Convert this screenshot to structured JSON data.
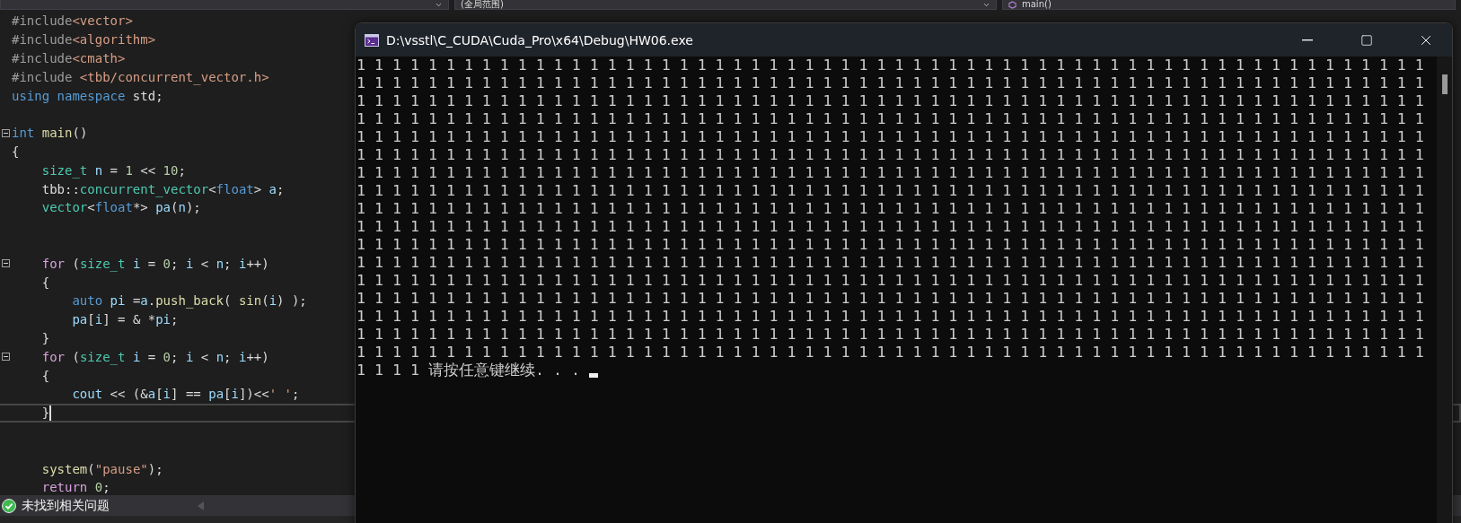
{
  "navigation_bar": {
    "scope": "(全局范围)",
    "member": "main()"
  },
  "editor": {
    "lines": [
      {
        "fold": false,
        "current": false,
        "tokens": [
          {
            "text": "#include",
            "kind": "pp"
          },
          {
            "text": "<vector>",
            "kind": "inc"
          }
        ]
      },
      {
        "fold": false,
        "current": false,
        "tokens": [
          {
            "text": "#include",
            "kind": "pp"
          },
          {
            "text": "<algorithm>",
            "kind": "inc"
          }
        ]
      },
      {
        "fold": false,
        "current": false,
        "tokens": [
          {
            "text": "#include",
            "kind": "pp"
          },
          {
            "text": "<cmath>",
            "kind": "inc"
          }
        ]
      },
      {
        "fold": false,
        "current": false,
        "tokens": [
          {
            "text": "#include",
            "kind": "pp"
          },
          {
            "text": " <tbb/concurrent_vector.h>",
            "kind": "inc"
          }
        ]
      },
      {
        "fold": false,
        "current": false,
        "tokens": [
          {
            "text": "using namespace",
            "kind": "kw"
          },
          {
            "text": " std;",
            "kind": "plain"
          }
        ]
      },
      {
        "fold": false,
        "current": false
      },
      {
        "fold": true,
        "current": false,
        "tokens": [
          {
            "text": "int",
            "kind": "kw"
          },
          {
            "text": " main",
            "kind": "fn"
          },
          {
            "text": "()",
            "kind": "plain"
          }
        ]
      },
      {
        "fold": false,
        "current": false,
        "tokens": [
          {
            "text": "{",
            "kind": "plain"
          }
        ]
      },
      {
        "fold": false,
        "current": false,
        "tokens": [
          {
            "text": "    size_t",
            "kind": "type"
          },
          {
            "text": " n",
            "kind": "var"
          },
          {
            "text": " = ",
            "kind": "plain"
          },
          {
            "text": "1",
            "kind": "num"
          },
          {
            "text": " << ",
            "kind": "plain"
          },
          {
            "text": "10",
            "kind": "num"
          },
          {
            "text": ";",
            "kind": "plain"
          }
        ]
      },
      {
        "fold": false,
        "current": false,
        "tokens": [
          {
            "text": "    tbb::",
            "kind": "plain"
          },
          {
            "text": "concurrent_vector",
            "kind": "type"
          },
          {
            "text": "<",
            "kind": "plain"
          },
          {
            "text": "float",
            "kind": "kw"
          },
          {
            "text": "> ",
            "kind": "plain"
          },
          {
            "text": "a",
            "kind": "var"
          },
          {
            "text": ";",
            "kind": "plain"
          }
        ]
      },
      {
        "fold": false,
        "current": false,
        "tokens": [
          {
            "text": "    vector",
            "kind": "type"
          },
          {
            "text": "<",
            "kind": "plain"
          },
          {
            "text": "float",
            "kind": "kw"
          },
          {
            "text": "*> ",
            "kind": "plain"
          },
          {
            "text": "pa",
            "kind": "var"
          },
          {
            "text": "(",
            "kind": "plain"
          },
          {
            "text": "n",
            "kind": "var"
          },
          {
            "text": ");",
            "kind": "plain"
          }
        ]
      },
      {
        "fold": false,
        "current": false
      },
      {
        "fold": false,
        "current": false
      },
      {
        "fold": true,
        "current": false,
        "tokens": [
          {
            "text": "    for",
            "kind": "ctl"
          },
          {
            "text": " (",
            "kind": "plain"
          },
          {
            "text": "size_t",
            "kind": "type"
          },
          {
            "text": " i",
            "kind": "var"
          },
          {
            "text": " = ",
            "kind": "plain"
          },
          {
            "text": "0",
            "kind": "num"
          },
          {
            "text": "; ",
            "kind": "plain"
          },
          {
            "text": "i",
            "kind": "var"
          },
          {
            "text": " < ",
            "kind": "plain"
          },
          {
            "text": "n",
            "kind": "var"
          },
          {
            "text": "; ",
            "kind": "plain"
          },
          {
            "text": "i",
            "kind": "var"
          },
          {
            "text": "++)",
            "kind": "plain"
          }
        ]
      },
      {
        "fold": false,
        "current": false,
        "tokens": [
          {
            "text": "    {",
            "kind": "plain"
          }
        ]
      },
      {
        "fold": false,
        "current": false,
        "tokens": [
          {
            "text": "        auto",
            "kind": "kw"
          },
          {
            "text": " pi",
            "kind": "var"
          },
          {
            "text": " =",
            "kind": "plain"
          },
          {
            "text": "a",
            "kind": "var"
          },
          {
            "text": ".",
            "kind": "plain"
          },
          {
            "text": "push_back",
            "kind": "fn"
          },
          {
            "text": "( ",
            "kind": "plain"
          },
          {
            "text": "sin",
            "kind": "fn"
          },
          {
            "text": "(",
            "kind": "plain"
          },
          {
            "text": "i",
            "kind": "var"
          },
          {
            "text": ") );",
            "kind": "plain"
          }
        ]
      },
      {
        "fold": false,
        "current": false,
        "tokens": [
          {
            "text": "        pa",
            "kind": "var"
          },
          {
            "text": "[",
            "kind": "plain"
          },
          {
            "text": "i",
            "kind": "var"
          },
          {
            "text": "] = & *",
            "kind": "plain"
          },
          {
            "text": "pi",
            "kind": "var"
          },
          {
            "text": ";",
            "kind": "plain"
          }
        ]
      },
      {
        "fold": false,
        "current": false,
        "tokens": [
          {
            "text": "    }",
            "kind": "plain"
          }
        ]
      },
      {
        "fold": true,
        "current": false,
        "tokens": [
          {
            "text": "    for",
            "kind": "ctl"
          },
          {
            "text": " (",
            "kind": "plain"
          },
          {
            "text": "size_t",
            "kind": "type"
          },
          {
            "text": " i",
            "kind": "var"
          },
          {
            "text": " = ",
            "kind": "plain"
          },
          {
            "text": "0",
            "kind": "num"
          },
          {
            "text": "; ",
            "kind": "plain"
          },
          {
            "text": "i",
            "kind": "var"
          },
          {
            "text": " < ",
            "kind": "plain"
          },
          {
            "text": "n",
            "kind": "var"
          },
          {
            "text": "; ",
            "kind": "plain"
          },
          {
            "text": "i",
            "kind": "var"
          },
          {
            "text": "++)",
            "kind": "plain"
          }
        ]
      },
      {
        "fold": false,
        "current": false,
        "tokens": [
          {
            "text": "    {",
            "kind": "plain"
          }
        ]
      },
      {
        "fold": false,
        "current": false,
        "tokens": [
          {
            "text": "        cout",
            "kind": "var"
          },
          {
            "text": " << (&",
            "kind": "plain"
          },
          {
            "text": "a",
            "kind": "var"
          },
          {
            "text": "[",
            "kind": "plain"
          },
          {
            "text": "i",
            "kind": "var"
          },
          {
            "text": "] == ",
            "kind": "plain"
          },
          {
            "text": "pa",
            "kind": "var"
          },
          {
            "text": "[",
            "kind": "plain"
          },
          {
            "text": "i",
            "kind": "var"
          },
          {
            "text": "])<<",
            "kind": "plain"
          },
          {
            "text": "' '",
            "kind": "str"
          },
          {
            "text": ";",
            "kind": "plain"
          }
        ]
      },
      {
        "fold": false,
        "current": true,
        "tokens": [
          {
            "text": "    }",
            "kind": "plain"
          }
        ]
      },
      {
        "fold": false,
        "current": false
      },
      {
        "fold": false,
        "current": false
      },
      {
        "fold": false,
        "current": false,
        "tokens": [
          {
            "text": "    system",
            "kind": "fn"
          },
          {
            "text": "(",
            "kind": "plain"
          },
          {
            "text": "\"pause\"",
            "kind": "str"
          },
          {
            "text": ");",
            "kind": "plain"
          }
        ]
      },
      {
        "fold": false,
        "current": false,
        "tokens": [
          {
            "text": "    return",
            "kind": "ctl"
          },
          {
            "text": " 0",
            "kind": "num"
          },
          {
            "text": ";",
            "kind": "plain"
          }
        ]
      }
    ]
  },
  "status_bar": {
    "message": "未找到相关问题"
  },
  "console": {
    "title": "D:\\vsstl\\C_CUDA\\Cuda_Pro\\x64\\Debug\\HW06.exe",
    "lines": [
      "1 1 1 1 1 1 1 1 1 1 1 1 1 1 1 1 1 1 1 1 1 1 1 1 1 1 1 1 1 1 1 1 1 1 1 1 1 1 1 1 1 1 1 1 1 1 1 1 1 1 1 1 1 1 1 1 1 1 1 1",
      "1 1 1 1 1 1 1 1 1 1 1 1 1 1 1 1 1 1 1 1 1 1 1 1 1 1 1 1 1 1 1 1 1 1 1 1 1 1 1 1 1 1 1 1 1 1 1 1 1 1 1 1 1 1 1 1 1 1 1 1",
      "1 1 1 1 1 1 1 1 1 1 1 1 1 1 1 1 1 1 1 1 1 1 1 1 1 1 1 1 1 1 1 1 1 1 1 1 1 1 1 1 1 1 1 1 1 1 1 1 1 1 1 1 1 1 1 1 1 1 1 1",
      "1 1 1 1 1 1 1 1 1 1 1 1 1 1 1 1 1 1 1 1 1 1 1 1 1 1 1 1 1 1 1 1 1 1 1 1 1 1 1 1 1 1 1 1 1 1 1 1 1 1 1 1 1 1 1 1 1 1 1 1",
      "1 1 1 1 1 1 1 1 1 1 1 1 1 1 1 1 1 1 1 1 1 1 1 1 1 1 1 1 1 1 1 1 1 1 1 1 1 1 1 1 1 1 1 1 1 1 1 1 1 1 1 1 1 1 1 1 1 1 1 1",
      "1 1 1 1 1 1 1 1 1 1 1 1 1 1 1 1 1 1 1 1 1 1 1 1 1 1 1 1 1 1 1 1 1 1 1 1 1 1 1 1 1 1 1 1 1 1 1 1 1 1 1 1 1 1 1 1 1 1 1 1",
      "1 1 1 1 1 1 1 1 1 1 1 1 1 1 1 1 1 1 1 1 1 1 1 1 1 1 1 1 1 1 1 1 1 1 1 1 1 1 1 1 1 1 1 1 1 1 1 1 1 1 1 1 1 1 1 1 1 1 1 1",
      "1 1 1 1 1 1 1 1 1 1 1 1 1 1 1 1 1 1 1 1 1 1 1 1 1 1 1 1 1 1 1 1 1 1 1 1 1 1 1 1 1 1 1 1 1 1 1 1 1 1 1 1 1 1 1 1 1 1 1 1",
      "1 1 1 1 1 1 1 1 1 1 1 1 1 1 1 1 1 1 1 1 1 1 1 1 1 1 1 1 1 1 1 1 1 1 1 1 1 1 1 1 1 1 1 1 1 1 1 1 1 1 1 1 1 1 1 1 1 1 1 1",
      "1 1 1 1 1 1 1 1 1 1 1 1 1 1 1 1 1 1 1 1 1 1 1 1 1 1 1 1 1 1 1 1 1 1 1 1 1 1 1 1 1 1 1 1 1 1 1 1 1 1 1 1 1 1 1 1 1 1 1 1",
      "1 1 1 1 1 1 1 1 1 1 1 1 1 1 1 1 1 1 1 1 1 1 1 1 1 1 1 1 1 1 1 1 1 1 1 1 1 1 1 1 1 1 1 1 1 1 1 1 1 1 1 1 1 1 1 1 1 1 1 1",
      "1 1 1 1 1 1 1 1 1 1 1 1 1 1 1 1 1 1 1 1 1 1 1 1 1 1 1 1 1 1 1 1 1 1 1 1 1 1 1 1 1 1 1 1 1 1 1 1 1 1 1 1 1 1 1 1 1 1 1 1",
      "1 1 1 1 1 1 1 1 1 1 1 1 1 1 1 1 1 1 1 1 1 1 1 1 1 1 1 1 1 1 1 1 1 1 1 1 1 1 1 1 1 1 1 1 1 1 1 1 1 1 1 1 1 1 1 1 1 1 1 1",
      "1 1 1 1 1 1 1 1 1 1 1 1 1 1 1 1 1 1 1 1 1 1 1 1 1 1 1 1 1 1 1 1 1 1 1 1 1 1 1 1 1 1 1 1 1 1 1 1 1 1 1 1 1 1 1 1 1 1 1 1",
      "1 1 1 1 1 1 1 1 1 1 1 1 1 1 1 1 1 1 1 1 1 1 1 1 1 1 1 1 1 1 1 1 1 1 1 1 1 1 1 1 1 1 1 1 1 1 1 1 1 1 1 1 1 1 1 1 1 1 1 1",
      "1 1 1 1 1 1 1 1 1 1 1 1 1 1 1 1 1 1 1 1 1 1 1 1 1 1 1 1 1 1 1 1 1 1 1 1 1 1 1 1 1 1 1 1 1 1 1 1 1 1 1 1 1 1 1 1 1 1 1 1",
      "1 1 1 1 1 1 1 1 1 1 1 1 1 1 1 1 1 1 1 1 1 1 1 1 1 1 1 1 1 1 1 1 1 1 1 1 1 1 1 1 1 1 1 1 1 1 1 1 1 1 1 1 1 1 1 1 1 1 1 1",
      "1 1 1 1 请按任意键继续. . ."
    ]
  }
}
